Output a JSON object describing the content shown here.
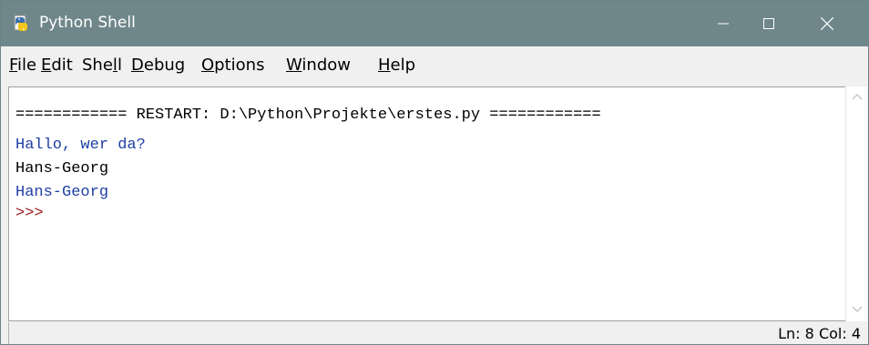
{
  "window": {
    "title": "Python  Shell",
    "controls": {
      "minimize": "—",
      "maximize": "☐",
      "close": "✕"
    }
  },
  "menu": {
    "items": [
      {
        "u": "F",
        "rest": "ile"
      },
      {
        "u": "E",
        "rest": "dit"
      },
      {
        "pre": "She",
        "u": "l",
        "rest": "l"
      },
      {
        "u": "D",
        "rest": "ebug"
      },
      {
        "u": "O",
        "rest": "ptions"
      },
      {
        "u": "W",
        "rest": "indow"
      },
      {
        "u": "H",
        "rest": "elp"
      }
    ]
  },
  "shell": {
    "restart_line": "============ RESTART: D:\\Python\\Projekte\\erstes.py ============",
    "lines": [
      "Hallo, wer da?",
      "Hans-Georg",
      "Hans-Georg",
      ">>>"
    ]
  },
  "status": {
    "position": "Ln: 8  Col: 4"
  },
  "colors": {
    "titlebar": "#6f878a",
    "output": "#1f3fa4",
    "prompt": "#9b1d20"
  }
}
